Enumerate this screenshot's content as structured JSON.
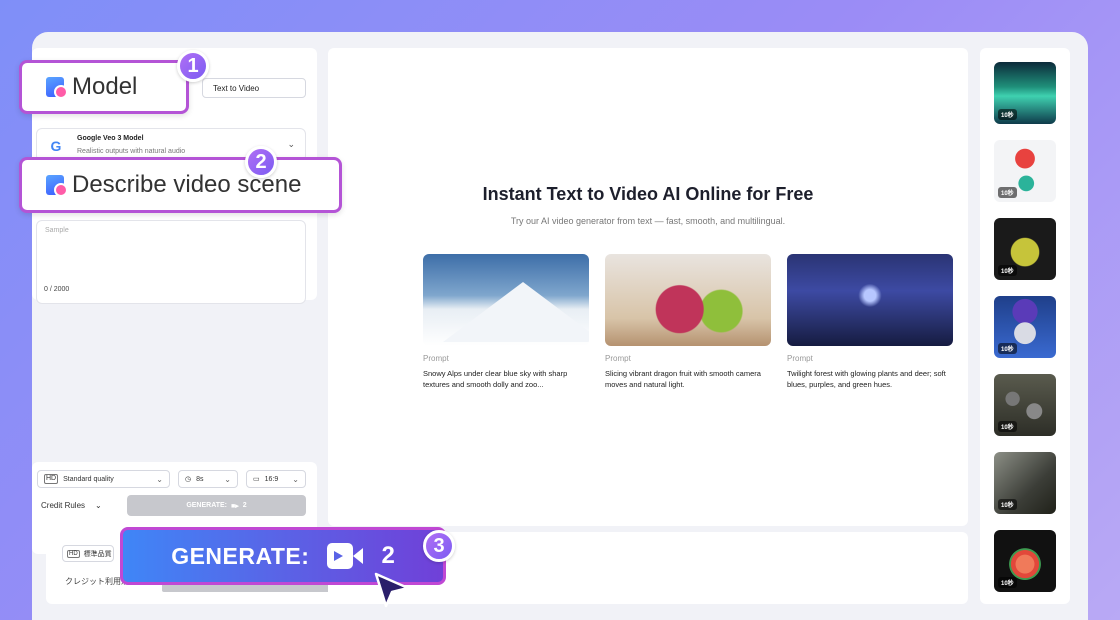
{
  "form": {
    "mode_tab": "Text to Video",
    "model_name": "Google Veo 3 Model",
    "model_desc": "Realistic outputs with natural audio",
    "prompt_placeholder": "Sample",
    "char_count": "0 / 2000",
    "quality": "Standard quality",
    "duration": "8s",
    "aspect": "16:9",
    "credit_rules": "Credit Rules",
    "generate_small": "GENERATE:",
    "generate_cost": "2",
    "jp_quality": "標準品質",
    "jp_credit": "クレジット利用規"
  },
  "hero": {
    "title": "Instant Text to Video AI Online for Free",
    "subtitle": "Try our AI video generator from text — fast, smooth, and multilingual."
  },
  "examples": [
    {
      "label": "Prompt",
      "text": "Snowy Alps under clear blue sky with sharp textures and smooth dolly and zoo..."
    },
    {
      "label": "Prompt",
      "text": "Slicing vibrant dragon fruit with smooth camera moves and natural light."
    },
    {
      "label": "Prompt",
      "text": "Twilight forest with glowing plants and deer; soft blues, purples, and green hues."
    }
  ],
  "thumbs": [
    {
      "dur": "10秒"
    },
    {
      "dur": "10秒"
    },
    {
      "dur": "10秒"
    },
    {
      "dur": "10秒"
    },
    {
      "dur": "10秒"
    },
    {
      "dur": "10秒"
    },
    {
      "dur": "10秒"
    }
  ],
  "callouts": {
    "step1_num": "1",
    "step1_text": "Model",
    "step2_num": "2",
    "step2_text": "Describe video scene",
    "step3_num": "3",
    "generate_label": "GENERATE:",
    "generate_cost": "2"
  }
}
